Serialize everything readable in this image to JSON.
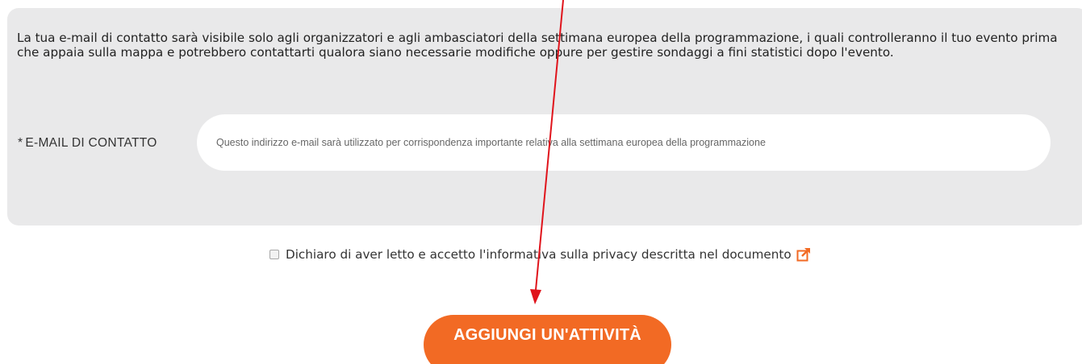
{
  "info": {
    "text": "La tua e-mail di contatto sarà visibile solo agli organizzatori e agli ambasciatori della settimana europea della programmazione, i quali controlleranno il tuo evento prima che appaia sulla mappa e potrebbero contattarti qualora siano necessarie modifiche oppure per gestire sondaggi a fini statistici dopo l'evento."
  },
  "email": {
    "required_mark": "*",
    "label": "E-MAIL DI CONTATTO",
    "placeholder": "Questo indirizzo e-mail sarà utilizzato per corrispondenza importante relativa alla settimana europea della programmazione",
    "value": ""
  },
  "privacy": {
    "checked": false,
    "label": "Dichiaro di aver letto e accetto l'informativa sulla privacy descritta nel documento",
    "link_icon": "external-link-icon"
  },
  "submit": {
    "label": "AGGIUNGI UN'ATTIVITÀ"
  },
  "colors": {
    "panel_bg": "#e9e9ea",
    "accent": "#f26a24",
    "annotation_arrow": "#e0141c"
  }
}
